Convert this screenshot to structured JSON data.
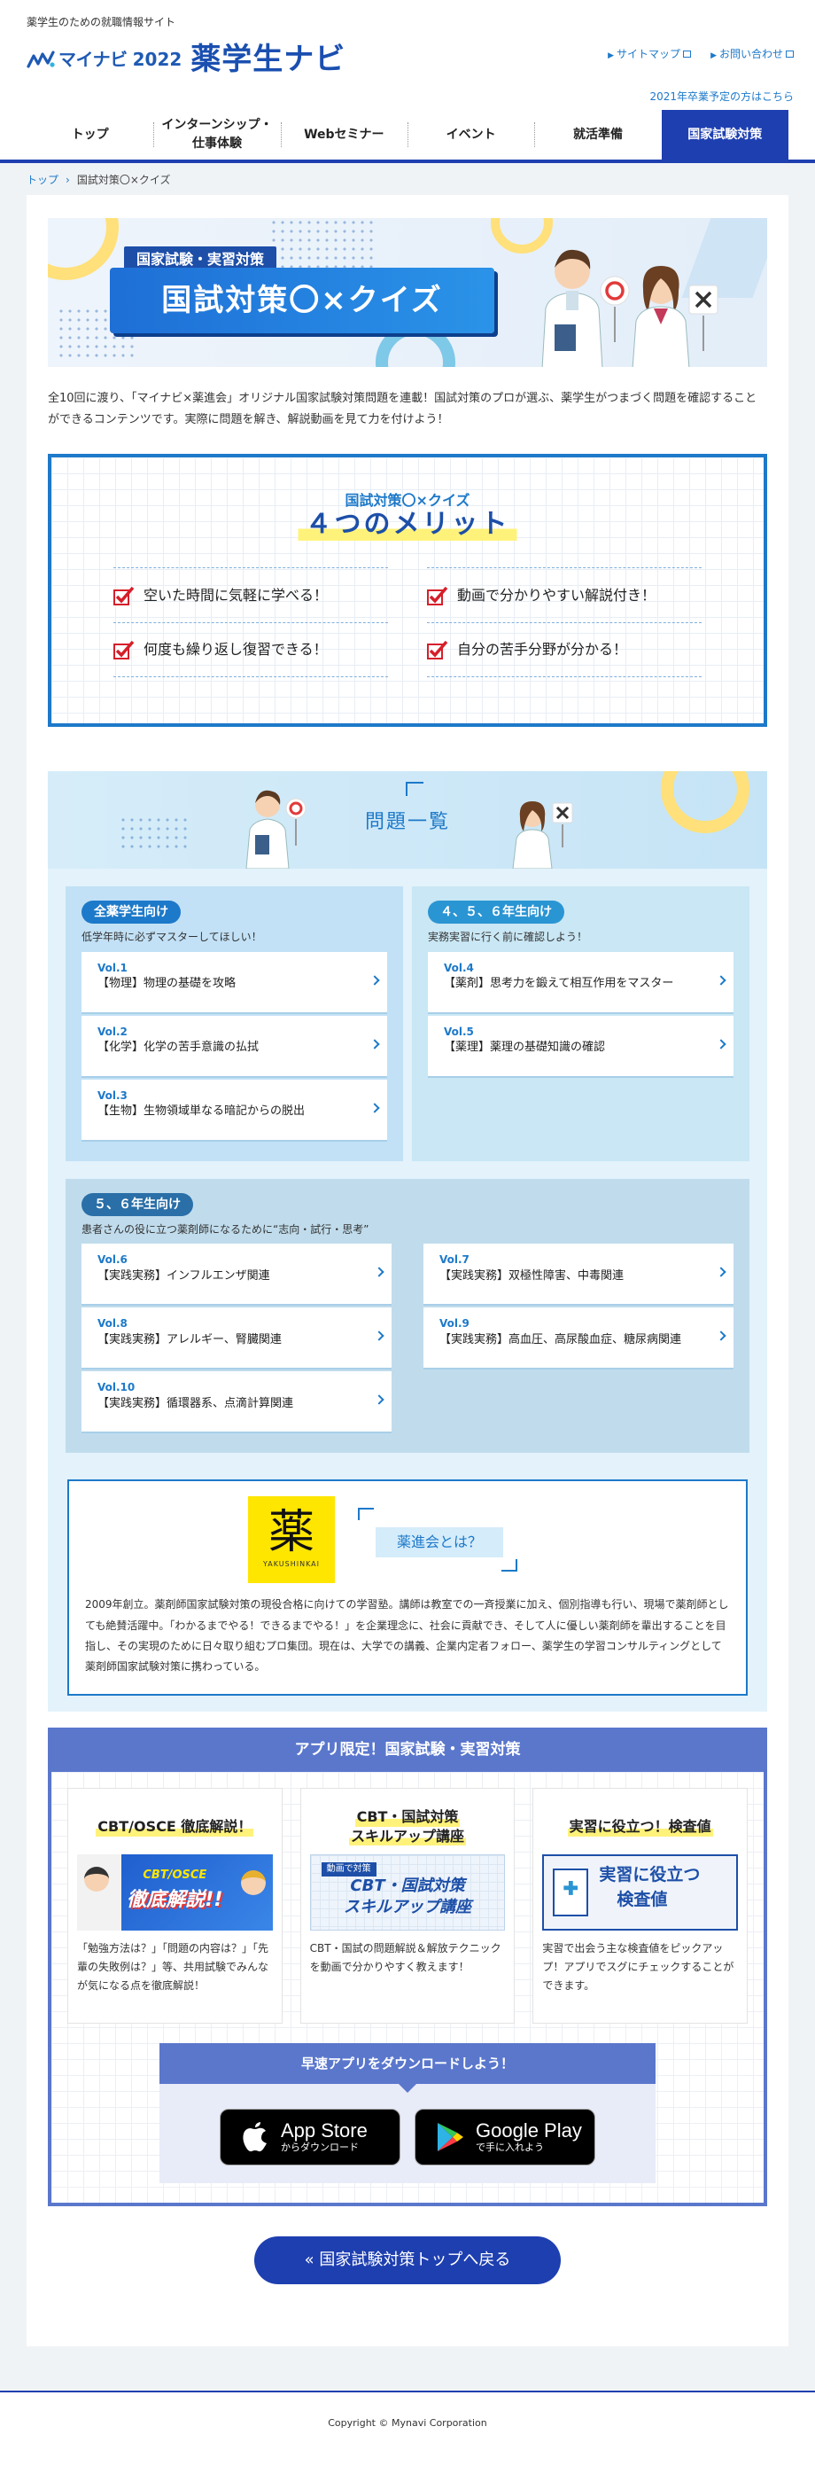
{
  "header": {
    "tagline": "薬学生のための就職情報サイト",
    "brand": "マイナビ",
    "year": "2022",
    "site_name": "薬学生ナビ",
    "links": {
      "sitemap": "サイトマップ",
      "contact": "お問い合わせ"
    },
    "grad_link": "2021年卒業予定の方はこちら"
  },
  "nav": {
    "items": [
      {
        "label": "トップ"
      },
      {
        "label": "インターンシップ・仕事体験"
      },
      {
        "label": "Webセミナー"
      },
      {
        "label": "イベント"
      },
      {
        "label": "就活準備"
      },
      {
        "label": "国家試験対策"
      }
    ]
  },
  "breadcrumb": {
    "home": "トップ",
    "current": "国試対策〇×クイズ"
  },
  "hero": {
    "tag": "国家試験・実習対策",
    "title": "国試対策〇×クイズ"
  },
  "intro": "全10回に渡り、「マイナビ×薬進会」オリジナル国家試験対策問題を連載！国試対策のプロが選ぶ、薬学生がつまづく問題を確認することができるコンテンツです。実際に問題を解き、解説動画を見て力を付けよう！",
  "merit": {
    "subtitle": "国試対策〇×クイズ",
    "title": "４つのメリット",
    "items": [
      "空いた時間に気軽に学べる！",
      "動画で分かりやすい解説付き！",
      "何度も繰り返し復習できる！",
      "自分の苦手分野が分かる！"
    ]
  },
  "questions": {
    "title": "問題一覧",
    "groups": [
      {
        "badge": "全薬学生向け",
        "desc": "低学年時に必ずマスターしてほしい！",
        "items": [
          {
            "vol": "Vol.1",
            "name": "【物理】物理の基礎を攻略"
          },
          {
            "vol": "Vol.2",
            "name": "【化学】化学の苦手意識の払拭"
          },
          {
            "vol": "Vol.3",
            "name": "【生物】生物領域単なる暗記からの脱出"
          }
        ]
      },
      {
        "badge": "４、５、６年生向け",
        "desc": "実務実習に行く前に確認しよう！",
        "items": [
          {
            "vol": "Vol.4",
            "name": "【薬剤】思考力を鍛えて相互作用をマスター"
          },
          {
            "vol": "Vol.5",
            "name": "【薬理】薬理の基礎知識の確認"
          }
        ]
      },
      {
        "badge": "５、６年生向け",
        "desc": "患者さんの役に立つ薬剤師になるために“志向・試行・思考”",
        "left": [
          {
            "vol": "Vol.6",
            "name": "【実践実務】インフルエンザ関連"
          },
          {
            "vol": "Vol.8",
            "name": "【実践実務】アレルギー、腎臓関連"
          },
          {
            "vol": "Vol.10",
            "name": "【実践実務】循環器系、点滴計算関連"
          }
        ],
        "right": [
          {
            "vol": "Vol.7",
            "name": "【実践実務】双極性障害、中毒関連"
          },
          {
            "vol": "Vol.9",
            "name": "【実践実務】高血圧、高尿酸血症、糖尿病関連"
          }
        ]
      }
    ]
  },
  "about": {
    "logo_kanji": "薬",
    "logo_en": "YAKUSHINKAI",
    "heading": "薬進会とは？",
    "text": "2009年創立。薬剤師国家試験対策の現役合格に向けての学習塾。講師は教室での一斉授業に加え、個別指導も行い、現場で薬剤師としても絶賛活躍中。「わかるまでやる！できるまでやる！」を企業理念に、社会に貢献でき、そして人に優しい薬剤師を輩出することを目指し、その実現のために日々取り組むプロ集団。現在は、大学での講義、企業内定者フォロー、薬学生の学習コンサルティングとして薬剤師国家試験対策に携わっている。"
  },
  "app": {
    "heading": "アプリ限定！国家試験・実習対策",
    "cards": [
      {
        "title": "CBT/OSCE 徹底解説！",
        "img_line1": "CBT/OSCE",
        "img_line2": "徹底解説!!",
        "text": "「勉強方法は？」「問題の内容は？」「先輩の失敗例は？」等、共用試験でみんなが気になる点を徹底解説！"
      },
      {
        "title_line1": "CBT・国試対策",
        "title_line2": "スキルアップ講座",
        "img_tag": "動画で対策",
        "img_line1": "CBT・国試対策",
        "img_line2": "スキルアップ講座",
        "text": "CBT・国試の問題解説＆解放テクニックを動画で分かりやすく教えます！"
      },
      {
        "title": "実習に役立つ！検査値",
        "img_line1": "実習に役立つ",
        "img_line2": "検査値",
        "text": "実習で出会う主な検査値をピックアップ！アプリでスグにチェックすることができます。"
      }
    ],
    "download": {
      "heading": "早速アプリをダウンロードしよう！",
      "appstore_big": "App Store",
      "appstore_small": "からダウンロード",
      "googleplay_big": "Google Play",
      "googleplay_small": "で手に入れよう"
    }
  },
  "back_button": "« 国家試験対策トップへ戻る",
  "footer": {
    "copyright": "Copyright © Mynavi Corporation"
  },
  "colors": {
    "primary": "#1e3fb0",
    "accent": "#1d79c9",
    "highlight": "#fff27a",
    "check": "#d61f2a"
  }
}
